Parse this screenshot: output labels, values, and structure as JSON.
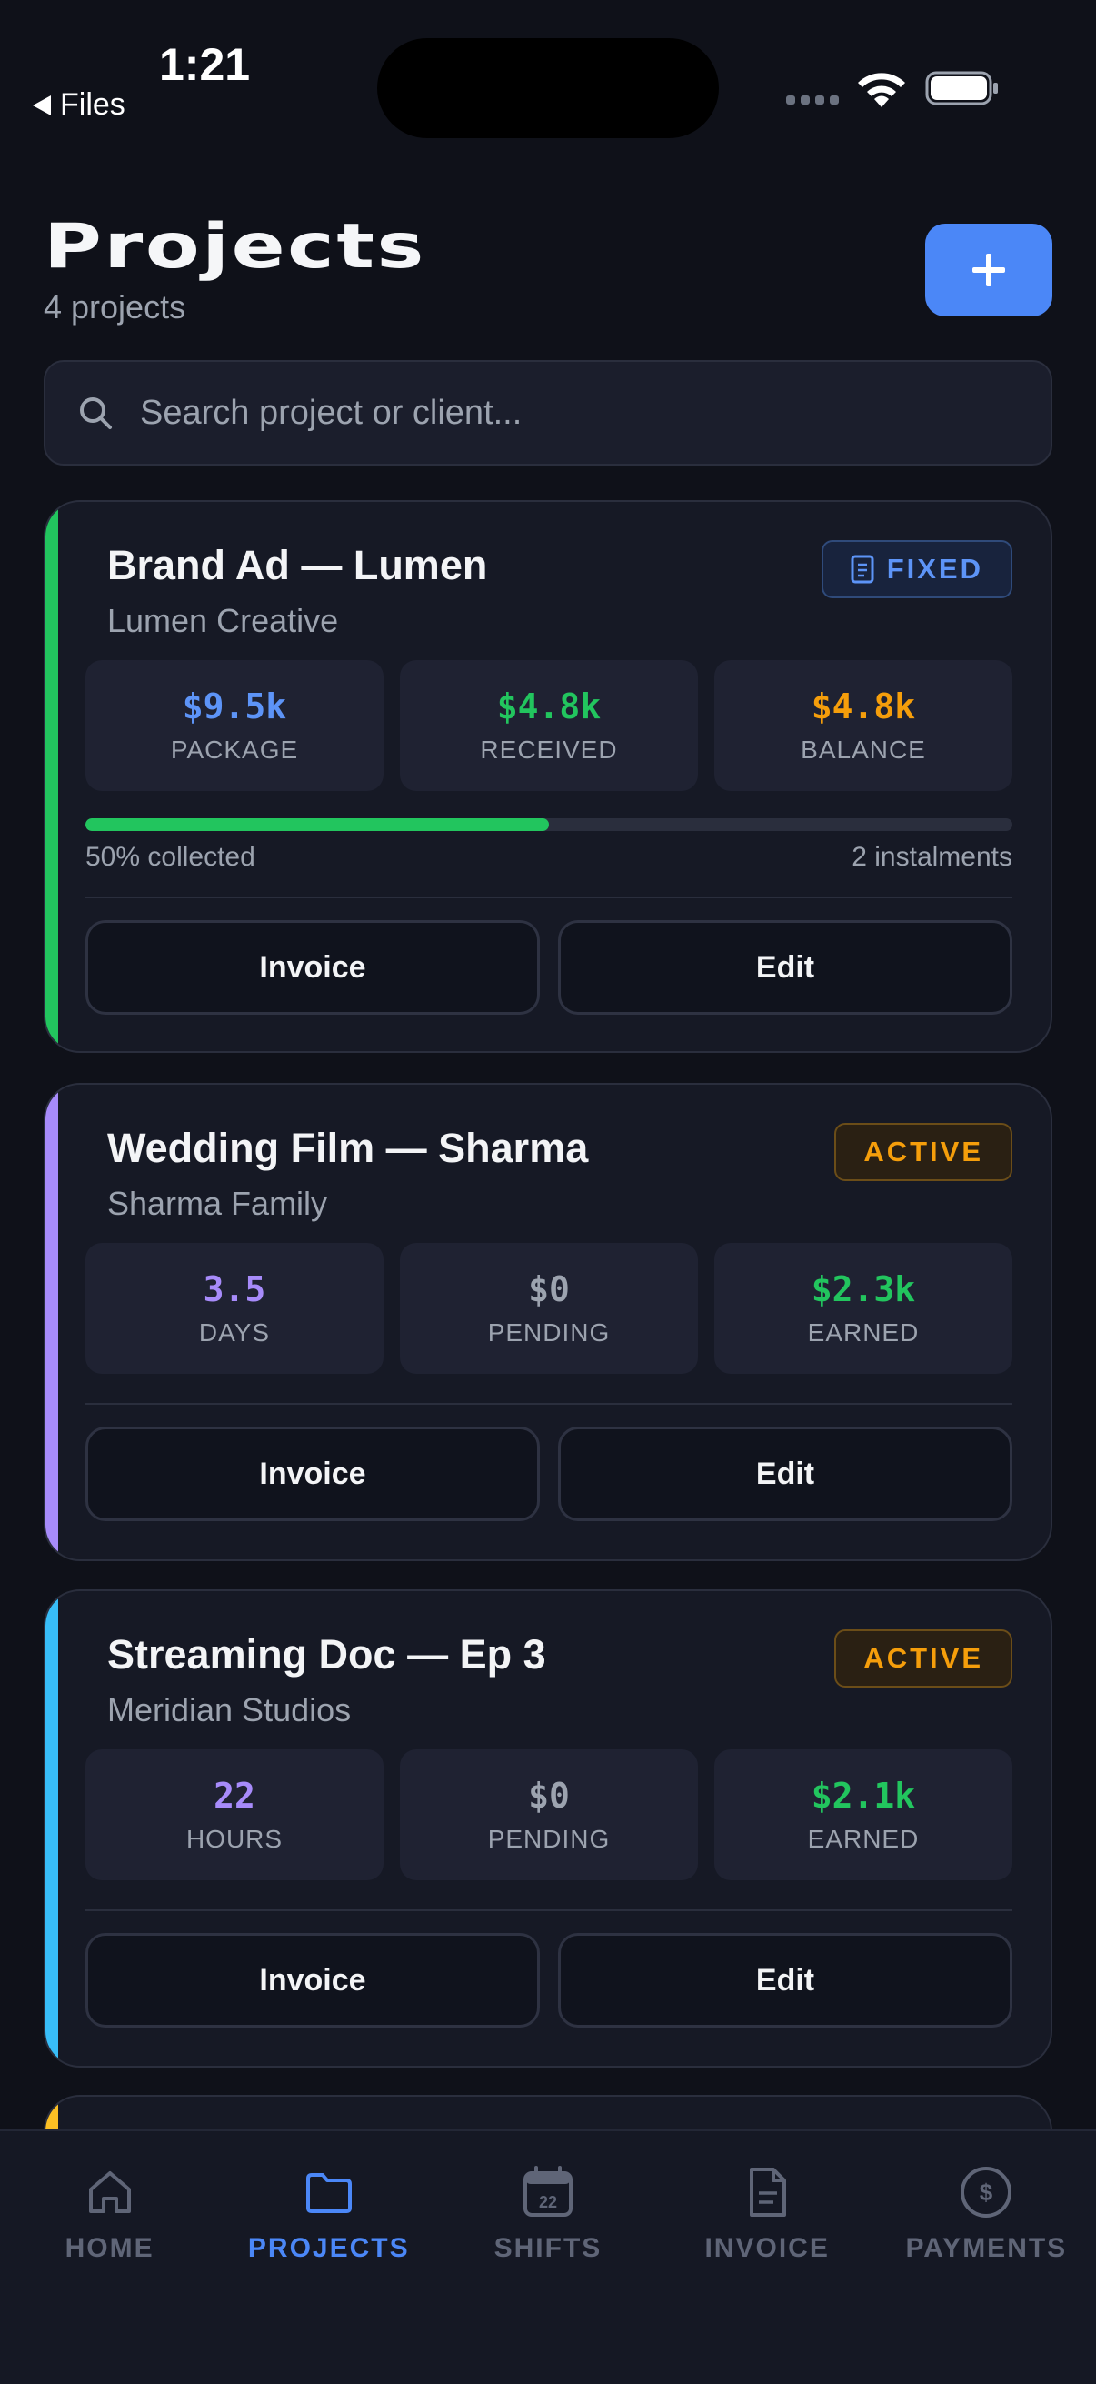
{
  "status_bar": {
    "time": "1:21",
    "back_label": "Files"
  },
  "header": {
    "title": "Projects",
    "subtitle": "4 projects"
  },
  "search": {
    "placeholder": "Search project or client..."
  },
  "projects": [
    {
      "title": "Brand Ad — Lumen",
      "client": "Lumen Creative",
      "badge": "FIXED",
      "accent_color": "#22c55e",
      "stats": [
        {
          "value": "$9.5k",
          "label": "PACKAGE",
          "color": "#5d94f7"
        },
        {
          "value": "$4.8k",
          "label": "RECEIVED",
          "color": "#22c55e"
        },
        {
          "value": "$4.8k",
          "label": "BALANCE",
          "color": "#f59e0b"
        }
      ],
      "progress": {
        "collected_fraction": 0.5,
        "left_label": "50% collected",
        "right_label": "2 instalments"
      },
      "actions": {
        "invoice": "Invoice",
        "edit": "Edit"
      }
    },
    {
      "title": "Wedding Film — Sharma",
      "client": "Sharma Family",
      "badge": "ACTIVE",
      "accent_color": "#a78bfa",
      "stats": [
        {
          "value": "3.5",
          "label": "DAYS",
          "color": "#a78bfa"
        },
        {
          "value": "$0",
          "label": "PENDING",
          "color": "#9ca3af"
        },
        {
          "value": "$2.3k",
          "label": "EARNED",
          "color": "#22c55e"
        }
      ],
      "actions": {
        "invoice": "Invoice",
        "edit": "Edit"
      }
    },
    {
      "title": "Streaming Doc — Ep 3",
      "client": "Meridian Studios",
      "badge": "ACTIVE",
      "accent_color": "#38bdf8",
      "stats": [
        {
          "value": "22",
          "label": "HOURS",
          "color": "#a78bfa"
        },
        {
          "value": "$0",
          "label": "PENDING",
          "color": "#9ca3af"
        },
        {
          "value": "$2.1k",
          "label": "EARNED",
          "color": "#22c55e"
        }
      ],
      "actions": {
        "invoice": "Invoice",
        "edit": "Edit"
      }
    }
  ],
  "tab_bar": {
    "active": "projects",
    "shifts_calendar_day": "22",
    "tabs": [
      {
        "label": "HOME",
        "icon": "home-icon"
      },
      {
        "label": "PROJECTS",
        "icon": "folder-icon"
      },
      {
        "label": "SHIFTS",
        "icon": "calendar-icon"
      },
      {
        "label": "INVOICE",
        "icon": "document-icon"
      },
      {
        "label": "PAYMENTS",
        "icon": "dollar-circle-icon"
      }
    ]
  },
  "colors": {
    "accent": "#4b87f7",
    "background": "#0f1119",
    "card": "#161925"
  }
}
